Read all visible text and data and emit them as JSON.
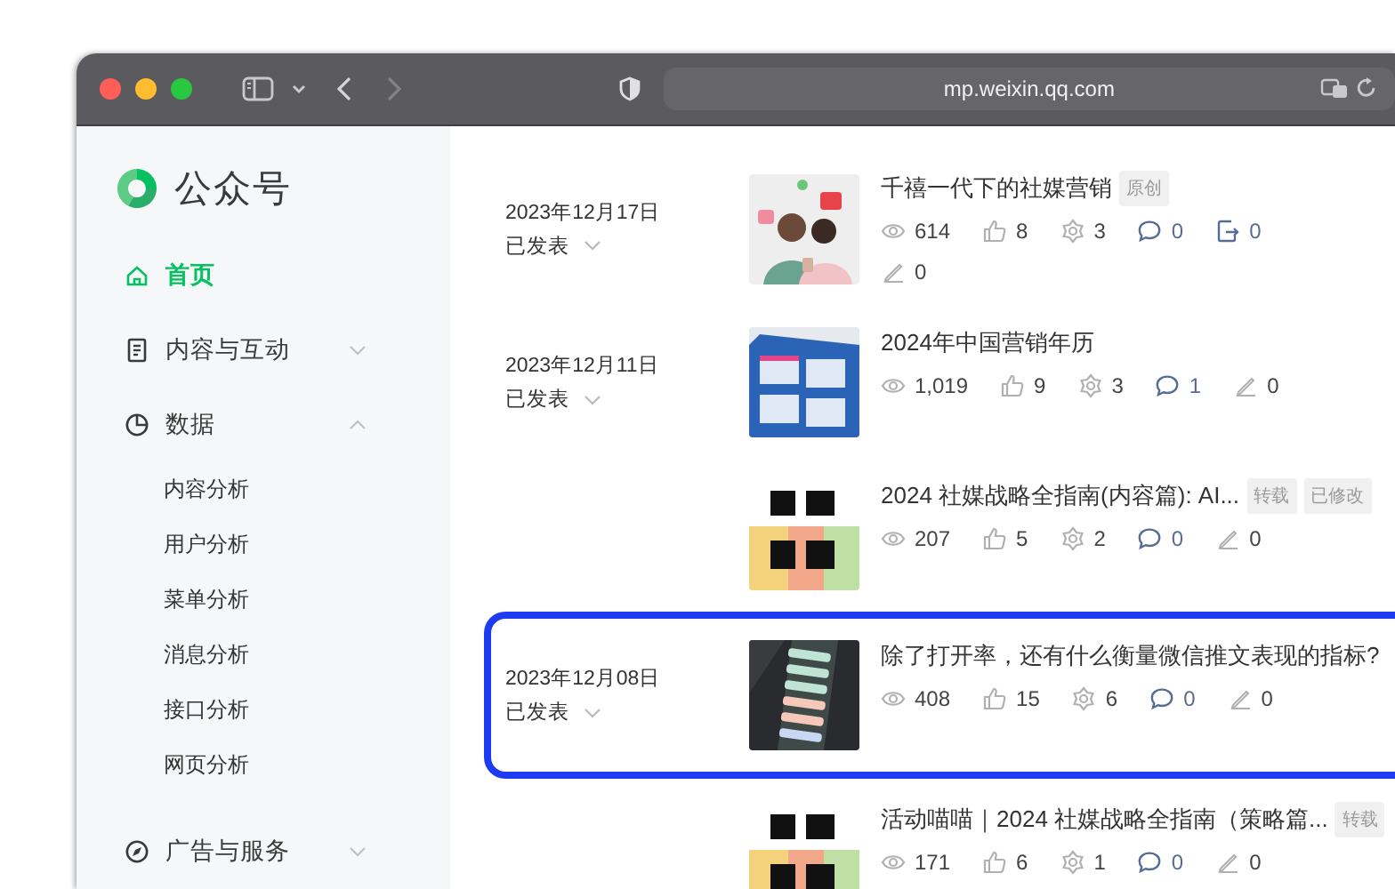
{
  "window": {
    "address": "mp.weixin.qq.com",
    "back_enabled": true,
    "forward_enabled": false
  },
  "sidebar": {
    "logo_text": "公众号",
    "items": [
      {
        "label": "首页",
        "selected": true
      },
      {
        "label": "内容与互动",
        "selected": false,
        "expanded": false
      },
      {
        "label": "数据",
        "selected": false,
        "expanded": true,
        "children": [
          {
            "label": "内容分析"
          },
          {
            "label": "用户分析"
          },
          {
            "label": "菜单分析"
          },
          {
            "label": "消息分析"
          },
          {
            "label": "接口分析"
          },
          {
            "label": "网页分析"
          }
        ]
      },
      {
        "label": "广告与服务",
        "selected": false,
        "expanded": false
      }
    ]
  },
  "articles": [
    {
      "date": "2023年12月17日",
      "status": "已发表",
      "title": "千禧一代下的社媒营销",
      "tags": [
        "原创"
      ],
      "highlighted": false,
      "stats": [
        {
          "kind": "views",
          "value": "614"
        },
        {
          "kind": "likes",
          "value": "8"
        },
        {
          "kind": "shares",
          "value": "3"
        },
        {
          "kind": "comments",
          "value": "0"
        },
        {
          "kind": "forwards",
          "value": "0"
        },
        {
          "kind": "edits",
          "value": "0"
        }
      ]
    },
    {
      "date": "2023年12月11日",
      "status": "已发表",
      "title": "2024年中国营销年历",
      "highlighted": false,
      "stats": [
        {
          "kind": "views",
          "value": "1,019"
        },
        {
          "kind": "likes",
          "value": "9"
        },
        {
          "kind": "shares",
          "value": "3"
        },
        {
          "kind": "comments",
          "value": "1"
        },
        {
          "kind": "edits",
          "value": "0"
        }
      ]
    },
    {
      "title": "2024 社媒战略全指南(内容篇): AI...",
      "tags": [
        "转载",
        "已修改"
      ],
      "highlighted": false,
      "stats": [
        {
          "kind": "views",
          "value": "207"
        },
        {
          "kind": "likes",
          "value": "5"
        },
        {
          "kind": "shares",
          "value": "2"
        },
        {
          "kind": "comments",
          "value": "0"
        },
        {
          "kind": "edits",
          "value": "0"
        }
      ]
    },
    {
      "date": "2023年12月08日",
      "status": "已发表",
      "title": "除了打开率，还有什么衡量微信推文表现的指标?",
      "highlighted": true,
      "stats": [
        {
          "kind": "views",
          "value": "408"
        },
        {
          "kind": "likes",
          "value": "15"
        },
        {
          "kind": "shares",
          "value": "6"
        },
        {
          "kind": "comments",
          "value": "0"
        },
        {
          "kind": "edits",
          "value": "0"
        }
      ]
    },
    {
      "title": "活动喵喵｜2024 社媒战略全指南（策略篇...",
      "tags": [
        "转载"
      ],
      "highlighted": false,
      "stats": [
        {
          "kind": "views",
          "value": "171"
        },
        {
          "kind": "likes",
          "value": "6"
        },
        {
          "kind": "shares",
          "value": "1"
        },
        {
          "kind": "comments",
          "value": "0"
        },
        {
          "kind": "edits",
          "value": "0"
        }
      ]
    }
  ]
}
